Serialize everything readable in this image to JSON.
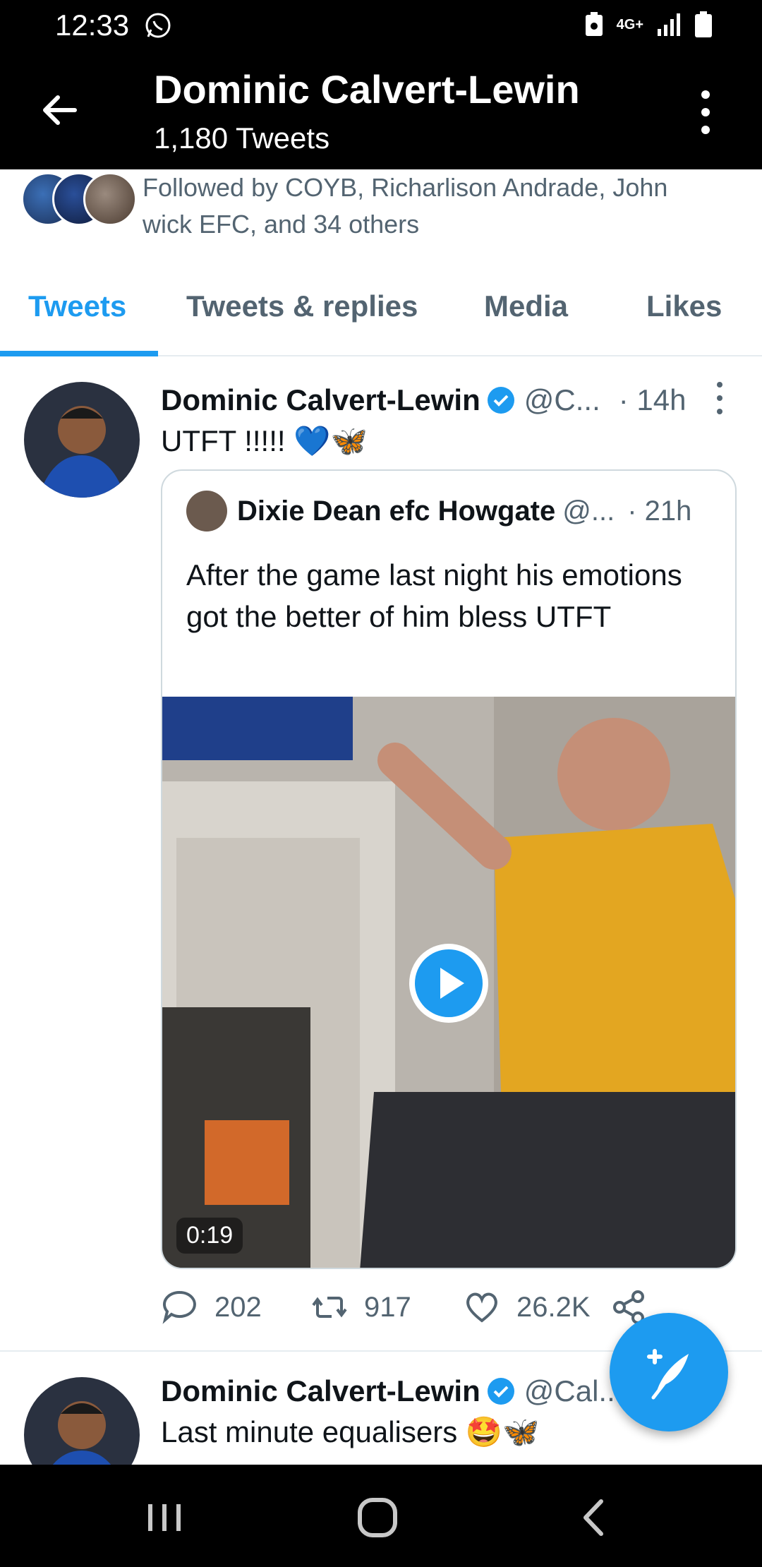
{
  "status_bar": {
    "time": "12:33",
    "network": "4G+",
    "icons": [
      "whatsapp-icon",
      "save-icon",
      "signal-icon",
      "battery-icon"
    ]
  },
  "header": {
    "title": "Dominic Calvert-Lewin",
    "subtitle": "1,180 Tweets",
    "icons": [
      "back-arrow-icon",
      "more-vertical-icon"
    ]
  },
  "followed_by": {
    "text": "Followed by COYB, Richarlison Andrade, John wick EFC, and 34 others"
  },
  "tabs": [
    {
      "label": "Tweets",
      "active": true
    },
    {
      "label": "Tweets & replies",
      "active": false
    },
    {
      "label": "Media",
      "active": false
    },
    {
      "label": "Likes",
      "active": false
    }
  ],
  "tweets": [
    {
      "name": "Dominic Calvert-Lewin",
      "handle": "@C...",
      "time": "· 14h",
      "text": "UTFT !!!!! 💙🦋",
      "quote": {
        "name": "Dixie Dean efc Howgate",
        "handle": "@...",
        "time": "· 21h",
        "text": "After the game last night his emotions got the better of him bless UTFT",
        "video_duration": "0:19"
      },
      "actions": {
        "replies": "202",
        "retweets": "917",
        "likes": "26.2K"
      }
    },
    {
      "name": "Dominic Calvert-Lewin",
      "handle": "@Cal...",
      "text": "Last minute equalisers 🤩🦋"
    }
  ],
  "colors": {
    "accent": "#1d9bf0",
    "text": "#0f1419",
    "secondary_text": "#536471",
    "bar_bg": "#000000"
  }
}
